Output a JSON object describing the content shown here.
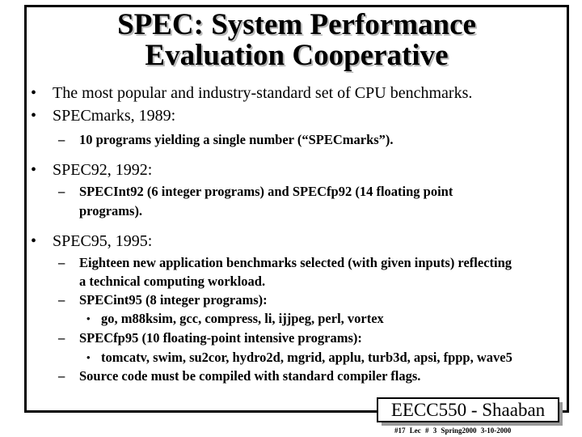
{
  "slide": {
    "title_line1": "SPEC: System Performance",
    "title_line2": "Evaluation Cooperative",
    "bullets": [
      {
        "marker": "•",
        "text": "The most popular and industry-standard set of CPU benchmarks."
      },
      {
        "marker": "•",
        "text": "SPECmarks, 1989:"
      },
      {
        "marker": "–",
        "text": "10 programs yielding a single number (“SPECmarks”)."
      },
      {
        "marker": "•",
        "text": "SPEC92, 1992:"
      },
      {
        "marker": "–",
        "text_line1": "SPECInt92 (6 integer programs) and SPECfp92  (14 floating point",
        "text_line2": "programs)."
      },
      {
        "marker": "•",
        "text": "SPEC95, 1995:"
      },
      {
        "marker": "–",
        "text_line1": "Eighteen new application benchmarks selected (with given inputs) reflecting",
        "text_line2": "a technical computing workload."
      },
      {
        "marker": "–",
        "text": "SPECint95 (8 integer programs):"
      },
      {
        "marker": "•",
        "text": "go, m88ksim, gcc, compress, li, ijjpeg, perl, vortex"
      },
      {
        "marker": "–",
        "text": "SPECfp95 (10 floating-point intensive programs):"
      },
      {
        "marker": "•",
        "text": "tomcatv, swim, su2cor, hydro2d, mgrid, applu, turb3d, apsi, fppp, wave5"
      },
      {
        "marker": "–",
        "text": "Source code must be compiled with standard compiler flags."
      }
    ]
  },
  "badge": {
    "label": "EECC550 - Shaaban"
  },
  "footer": {
    "text": "#17   Lec # 3    Spring2000   3-10-2000"
  }
}
